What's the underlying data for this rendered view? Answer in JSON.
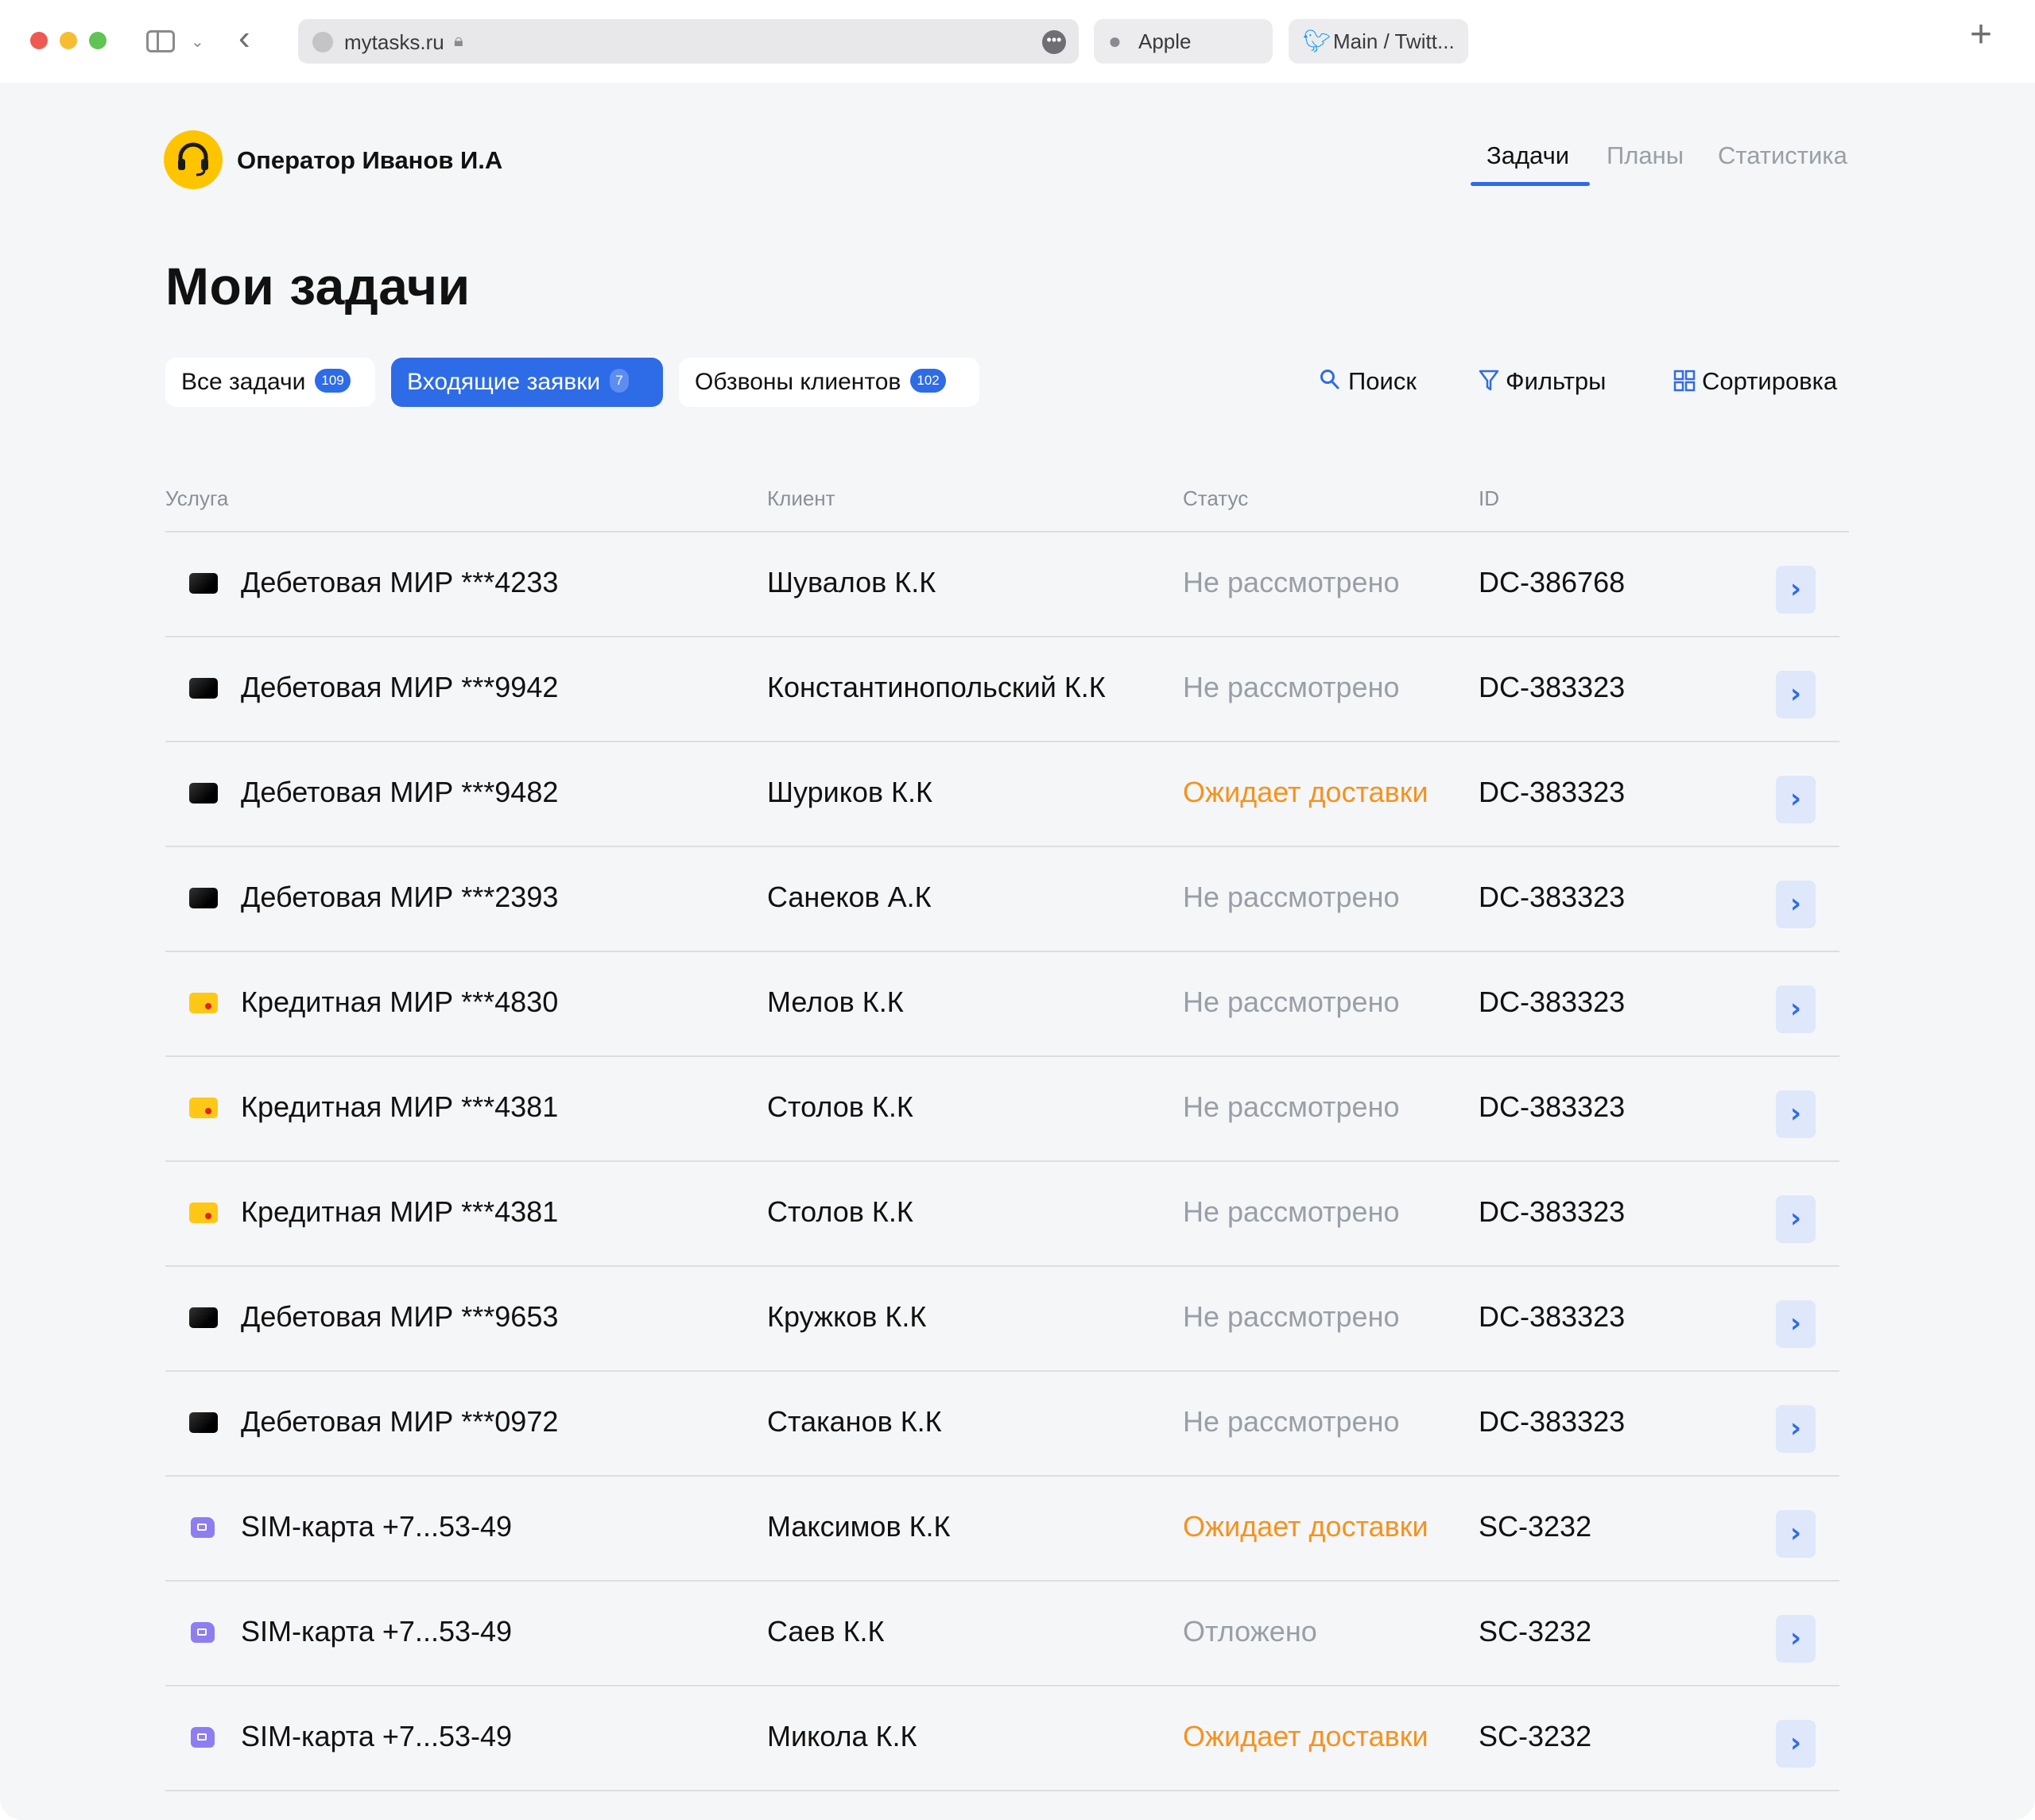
{
  "browser": {
    "url": "mytasks.ru",
    "tabs": [
      {
        "label": "Apple",
        "icon": "apple-icon"
      },
      {
        "label": "Main / Twitt...",
        "icon": "twitter-icon"
      }
    ]
  },
  "header": {
    "operator_name": "Оператор Иванов И.А",
    "nav": [
      {
        "label": "Задачи",
        "active": true
      },
      {
        "label": "Планы",
        "active": false
      },
      {
        "label": "Статистика",
        "active": false
      }
    ]
  },
  "page": {
    "title": "Мои задачи"
  },
  "chips": [
    {
      "label": "Все задачи",
      "count": "109",
      "active": false
    },
    {
      "label": "Входящие заявки",
      "count": "7",
      "active": true
    },
    {
      "label": "Обзвоны клиентов",
      "count": "102",
      "active": false
    }
  ],
  "tools": {
    "search": "Поиск",
    "filters": "Фильтры",
    "sort": "Сортировка"
  },
  "table": {
    "columns": {
      "service": "Услуга",
      "client": "Клиент",
      "status": "Статус",
      "id": "ID"
    },
    "rows": [
      {
        "type": "debit",
        "service": "Дебетовая МИР ***4233",
        "client": "Шувалов К.К",
        "status": "Не рассмотрено",
        "status_kind": "neutral",
        "id": "DC-386768"
      },
      {
        "type": "debit",
        "service": "Дебетовая МИР ***9942",
        "client": "Константинопольский К.К",
        "status": "Не рассмотрено",
        "status_kind": "neutral",
        "id": "DC-383323"
      },
      {
        "type": "debit",
        "service": "Дебетовая МИР ***9482",
        "client": "Шуриков К.К",
        "status": "Ожидает доставки",
        "status_kind": "warn",
        "id": "DC-383323"
      },
      {
        "type": "debit",
        "service": "Дебетовая МИР ***2393",
        "client": "Санеков А.К",
        "status": "Не рассмотрено",
        "status_kind": "neutral",
        "id": "DC-383323"
      },
      {
        "type": "credit",
        "service": "Кредитная МИР ***4830",
        "client": "Мелов К.К",
        "status": "Не рассмотрено",
        "status_kind": "neutral",
        "id": "DC-383323"
      },
      {
        "type": "credit",
        "service": "Кредитная МИР ***4381",
        "client": "Столов К.К",
        "status": "Не рассмотрено",
        "status_kind": "neutral",
        "id": "DC-383323"
      },
      {
        "type": "credit",
        "service": "Кредитная МИР ***4381",
        "client": "Столов К.К",
        "status": "Не рассмотрено",
        "status_kind": "neutral",
        "id": "DC-383323"
      },
      {
        "type": "debit",
        "service": "Дебетовая МИР ***9653",
        "client": "Кружков К.К",
        "status": "Не рассмотрено",
        "status_kind": "neutral",
        "id": "DC-383323"
      },
      {
        "type": "debit",
        "service": "Дебетовая МИР ***0972",
        "client": "Стаканов К.К",
        "status": "Не рассмотрено",
        "status_kind": "neutral",
        "id": "DC-383323"
      },
      {
        "type": "sim",
        "service": "SIM-карта  +7...53-49",
        "client": "Максимов К.К",
        "status": "Ожидает доставки",
        "status_kind": "warn",
        "id": "SC-3232"
      },
      {
        "type": "sim",
        "service": "SIM-карта  +7...53-49",
        "client": "Саев К.К",
        "status": "Отложено",
        "status_kind": "neutral",
        "id": "SC-3232"
      },
      {
        "type": "sim",
        "service": "SIM-карта  +7...53-49",
        "client": "Микола К.К",
        "status": "Ожидает доставки",
        "status_kind": "warn",
        "id": "SC-3232"
      }
    ]
  },
  "colors": {
    "accent": "#2e6be6",
    "warning": "#f5921e",
    "muted": "#9a9ea6",
    "avatar": "#ffc400"
  }
}
